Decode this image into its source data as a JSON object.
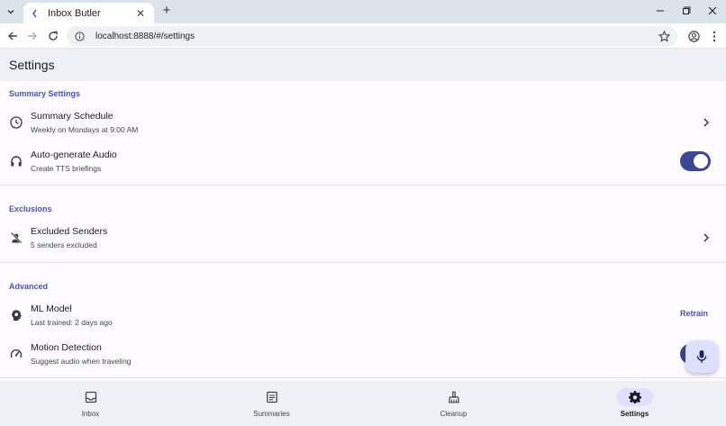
{
  "browser": {
    "tab_title": "Inbox Butler",
    "url": "localhost:8888/#/settings"
  },
  "appbar": {
    "title": "Settings"
  },
  "sections": {
    "summary": {
      "header": "Summary Settings",
      "schedule": {
        "title": "Summary Schedule",
        "subtitle": "Weekly on Mondays at 9:00 AM",
        "icon": "clock-icon"
      },
      "audio": {
        "title": "Auto-generate Audio",
        "subtitle": "Create TTS briefings",
        "icon": "headphones-icon",
        "enabled": true
      }
    },
    "exclusions": {
      "header": "Exclusions",
      "senders": {
        "title": "Excluded Senders",
        "subtitle": "5 senders excluded",
        "icon": "person-off-icon"
      }
    },
    "advanced": {
      "header": "Advanced",
      "ml_model": {
        "title": "ML Model",
        "subtitle": "Last trained: 2 days ago",
        "action": "Retrain",
        "icon": "psychology-icon"
      },
      "motion": {
        "title": "Motion Detection",
        "subtitle": "Suggest audio when traveling",
        "icon": "speed-icon",
        "enabled": true
      }
    }
  },
  "fab": {
    "icon": "mic-icon"
  },
  "bottom_nav": [
    {
      "label": "Inbox",
      "icon": "inbox-icon",
      "active": false
    },
    {
      "label": "Summaries",
      "icon": "article-icon",
      "active": false
    },
    {
      "label": "Cleanup",
      "icon": "cleaning-icon",
      "active": false
    },
    {
      "label": "Settings",
      "icon": "gear-icon",
      "active": true
    }
  ],
  "colors": {
    "accent": "#4a55b0",
    "toggle_on": "#3c4596",
    "nav_indicator": "#dfe0ff"
  }
}
